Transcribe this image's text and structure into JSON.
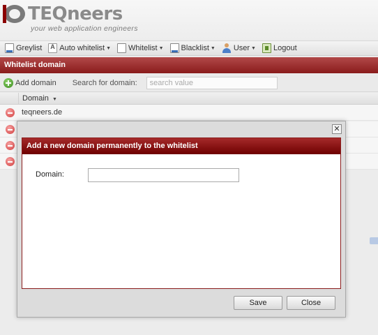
{
  "brand": {
    "logo_text_main": "TEQ",
    "logo_text_tail": "neers",
    "tagline": "your web application engineers"
  },
  "menu": {
    "items": [
      {
        "label": "Greylist",
        "icon": "document-icon",
        "has_caret": false
      },
      {
        "label": "Auto whitelist",
        "icon": "auto-document-icon",
        "has_caret": true
      },
      {
        "label": "Whitelist",
        "icon": "blank-document-icon",
        "has_caret": true
      },
      {
        "label": "Blacklist",
        "icon": "document-icon",
        "has_caret": true
      },
      {
        "label": "User",
        "icon": "user-icon",
        "has_caret": true
      },
      {
        "label": "Logout",
        "icon": "logout-icon",
        "has_caret": false
      }
    ]
  },
  "panel": {
    "title": "Whitelist domain"
  },
  "toolbar": {
    "add_label": "Add domain",
    "search_label": "Search for domain:",
    "search_placeholder": "search value"
  },
  "grid": {
    "column_domain": "Domain",
    "rows": [
      {
        "domain": "teqneers.de"
      },
      {
        "domain": ""
      },
      {
        "domain": ""
      },
      {
        "domain": ""
      }
    ]
  },
  "dialog": {
    "close_symbol": "✕",
    "title": "Add a new domain permanently to the whitelist",
    "domain_label": "Domain:",
    "domain_value": "",
    "save_label": "Save",
    "close_label": "Close"
  },
  "colors": {
    "accent": "#8a1c1c",
    "panel_title_top": "#b14848",
    "add_green": "#3a8a1e",
    "delete_red": "#d23c3c"
  }
}
